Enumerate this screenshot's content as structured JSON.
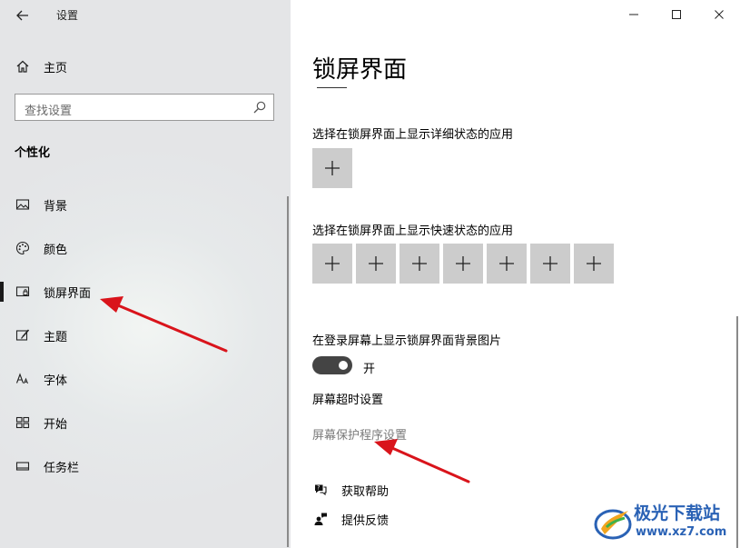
{
  "window": {
    "title": "设置",
    "buttons": {
      "minimize": "—",
      "maximize": "☐",
      "close": "✕"
    }
  },
  "sidebar": {
    "home": "主页",
    "search_placeholder": "查找设置",
    "section": "个性化",
    "items": [
      {
        "label": "背景",
        "icon": "background-image-icon"
      },
      {
        "label": "颜色",
        "icon": "palette-icon"
      },
      {
        "label": "锁屏界面",
        "icon": "lock-screen-icon",
        "selected": true
      },
      {
        "label": "主题",
        "icon": "theme-brush-icon"
      },
      {
        "label": "字体",
        "icon": "font-icon"
      },
      {
        "label": "开始",
        "icon": "start-menu-icon"
      },
      {
        "label": "任务栏",
        "icon": "taskbar-icon"
      }
    ]
  },
  "main": {
    "title": "锁屏界面",
    "detailed_status_label": "选择在锁屏界面上显示详细状态的应用",
    "detailed_status_tiles": [
      "+"
    ],
    "quick_status_label": "选择在锁屏界面上显示快速状态的应用",
    "quick_status_tiles": [
      "+",
      "+",
      "+",
      "+",
      "+",
      "+",
      "+"
    ],
    "signin_bg_label": "在登录屏幕上显示锁屏界面背景图片",
    "toggle_state": "开",
    "toggle_on": true,
    "screen_timeout_link": "屏幕超时设置",
    "screensaver_link": "屏幕保护程序设置",
    "get_help": "获取帮助",
    "give_feedback": "提供反馈"
  },
  "watermark": {
    "line1": "极光下载站",
    "line2": "www.xz7.com"
  },
  "colors": {
    "annotation_arrow": "#d9141b",
    "tile_bg": "#cccccc",
    "toggle_bg": "#444444",
    "watermark_blue": "#2a62b5"
  }
}
